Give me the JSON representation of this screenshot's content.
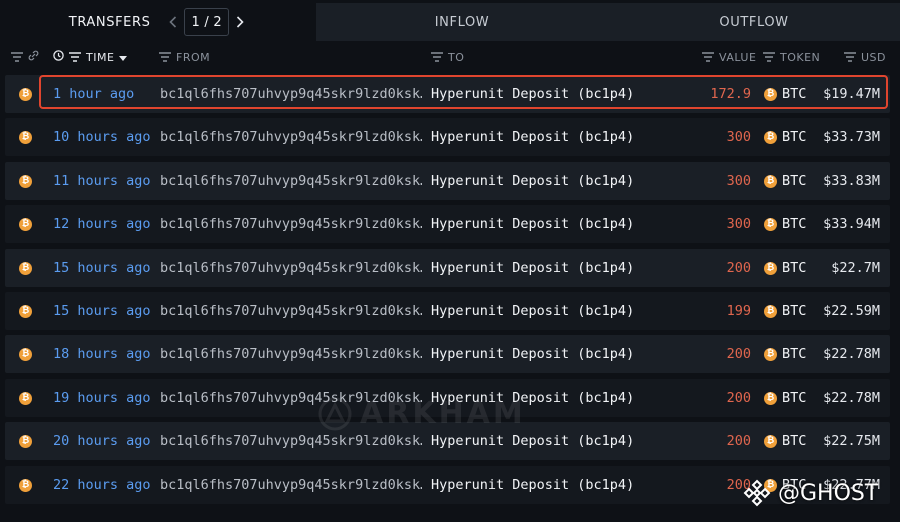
{
  "tabs": {
    "transfers_label": "TRANSFERS",
    "inflow_label": "INFLOW",
    "outflow_label": "OUTFLOW",
    "pager": {
      "current": "1",
      "separator": "/",
      "total": "2"
    }
  },
  "columns": {
    "time": "TIME",
    "from": "FROM",
    "to": "TO",
    "value": "VALUE",
    "token": "TOKEN",
    "usd": "USD"
  },
  "rows": [
    {
      "time": "1 hour ago",
      "from": "bc1ql6fhs707uhvyp9q45skr9lzd0ksk…",
      "to": "Hyperunit Deposit (bc1p4)",
      "value": "172.9",
      "token": "BTC",
      "usd": "$19.47M"
    },
    {
      "time": "10 hours ago",
      "from": "bc1ql6fhs707uhvyp9q45skr9lzd0ksk…",
      "to": "Hyperunit Deposit (bc1p4)",
      "value": "300",
      "token": "BTC",
      "usd": "$33.73M"
    },
    {
      "time": "11 hours ago",
      "from": "bc1ql6fhs707uhvyp9q45skr9lzd0ksk…",
      "to": "Hyperunit Deposit (bc1p4)",
      "value": "300",
      "token": "BTC",
      "usd": "$33.83M"
    },
    {
      "time": "12 hours ago",
      "from": "bc1ql6fhs707uhvyp9q45skr9lzd0ksk…",
      "to": "Hyperunit Deposit (bc1p4)",
      "value": "300",
      "token": "BTC",
      "usd": "$33.94M"
    },
    {
      "time": "15 hours ago",
      "from": "bc1ql6fhs707uhvyp9q45skr9lzd0ksk…",
      "to": "Hyperunit Deposit (bc1p4)",
      "value": "200",
      "token": "BTC",
      "usd": "$22.7M"
    },
    {
      "time": "15 hours ago",
      "from": "bc1ql6fhs707uhvyp9q45skr9lzd0ksk…",
      "to": "Hyperunit Deposit (bc1p4)",
      "value": "199",
      "token": "BTC",
      "usd": "$22.59M"
    },
    {
      "time": "18 hours ago",
      "from": "bc1ql6fhs707uhvyp9q45skr9lzd0ksk…",
      "to": "Hyperunit Deposit (bc1p4)",
      "value": "200",
      "token": "BTC",
      "usd": "$22.78M"
    },
    {
      "time": "19 hours ago",
      "from": "bc1ql6fhs707uhvyp9q45skr9lzd0ksk…",
      "to": "Hyperunit Deposit (bc1p4)",
      "value": "200",
      "token": "BTC",
      "usd": "$22.78M"
    },
    {
      "time": "20 hours ago",
      "from": "bc1ql6fhs707uhvyp9q45skr9lzd0ksk…",
      "to": "Hyperunit Deposit (bc1p4)",
      "value": "200",
      "token": "BTC",
      "usd": "$22.75M"
    },
    {
      "time": "22 hours ago",
      "from": "bc1ql6fhs707uhvyp9q45skr9lzd0ksk…",
      "to": "Hyperunit Deposit (bc1p4)",
      "value": "200",
      "token": "BTC",
      "usd": "$22.77M"
    }
  ],
  "watermarks": {
    "center": "ARKHAM",
    "corner": "@GHOST"
  },
  "colors": {
    "accent_link": "#5b9cf0",
    "value_red": "#e0664e",
    "btc_orange": "#f0a03a",
    "highlight_red": "#e0452e"
  },
  "icons": {
    "row_icon": "bitcoin-icon",
    "token_icon": "bitcoin-icon",
    "filter": "filter-icon",
    "clock": "clock-icon",
    "sort": "sort-down-icon",
    "link": "link-icon",
    "prev": "chevron-left-icon",
    "next": "chevron-right-icon"
  }
}
